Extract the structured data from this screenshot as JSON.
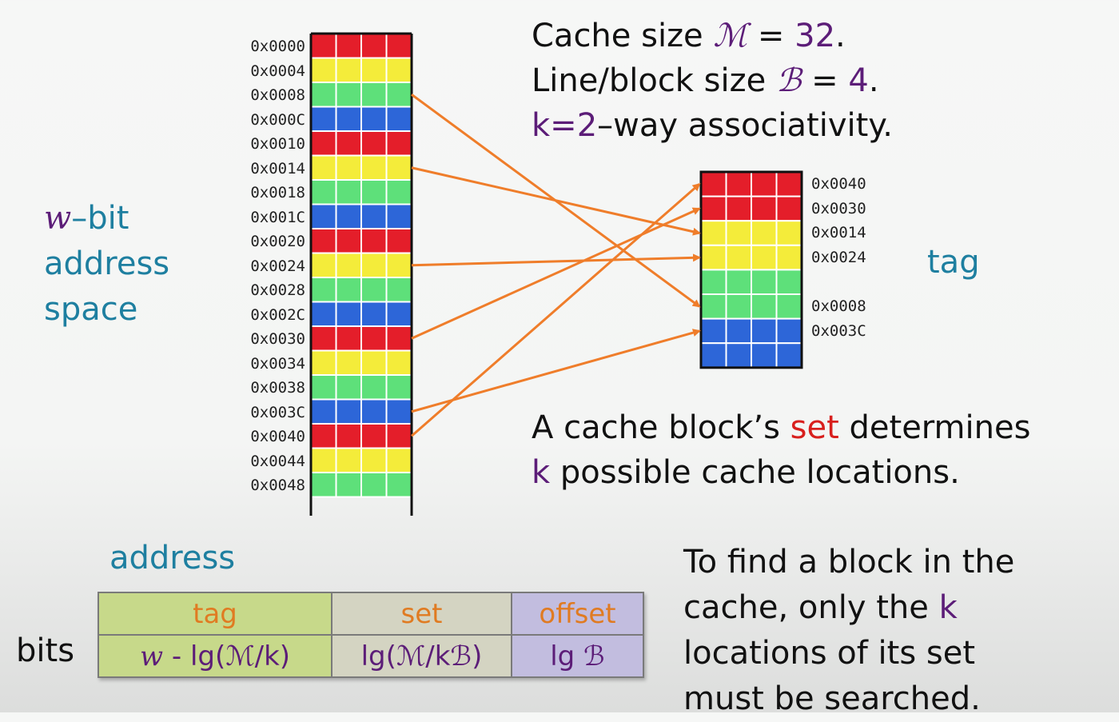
{
  "memory": {
    "addresses": [
      "0x0000",
      "0x0004",
      "0x0008",
      "0x000C",
      "0x0010",
      "0x0014",
      "0x0018",
      "0x001C",
      "0x0020",
      "0x0024",
      "0x0028",
      "0x002C",
      "0x0030",
      "0x0034",
      "0x0038",
      "0x003C",
      "0x0040",
      "0x0044",
      "0x0048"
    ],
    "row_colors": [
      "red",
      "yellow",
      "green",
      "blue",
      "red",
      "yellow",
      "green",
      "blue",
      "red",
      "yellow",
      "green",
      "blue",
      "red",
      "yellow",
      "green",
      "blue",
      "red",
      "yellow",
      "green"
    ]
  },
  "cache": {
    "tags": [
      "0x0040",
      "0x0030",
      "0x0014",
      "0x0024",
      "",
      "0x0008",
      "0x003C",
      ""
    ],
    "row_colors": [
      "red",
      "red",
      "yellow",
      "yellow",
      "green",
      "green",
      "blue",
      "blue"
    ]
  },
  "mappings": [
    {
      "from": "0x0008",
      "to_row": 5
    },
    {
      "from": "0x0014",
      "to_row": 2
    },
    {
      "from": "0x0024",
      "to_row": 3
    },
    {
      "from": "0x0030",
      "to_row": 1
    },
    {
      "from": "0x003C",
      "to_row": 6
    },
    {
      "from": "0x0040",
      "to_row": 0
    }
  ],
  "colors": {
    "red": "#e41e2a",
    "yellow": "#f4ec3a",
    "green": "#5ee07a",
    "blue": "#2d66d8",
    "arrow": "#ef7d2a",
    "teal": "#1e7fa0",
    "purple": "#5c1d78"
  },
  "header": {
    "line1_prefix": "Cache size ",
    "line1_sym": "ℳ",
    "line1_eq": " = ",
    "line1_val": "32",
    "line1_end": ".",
    "line2_prefix": "Line/block size ",
    "line2_sym": "ℬ",
    "line2_eq": " = ",
    "line2_val": "4",
    "line2_end": ".",
    "line3_k": "k",
    "line3_eq": "=",
    "line3_val": "2",
    "line3_rest": "–way associativity."
  },
  "left_label": {
    "w": "w",
    "bit": "–bit",
    "line2": "address",
    "line3": "space"
  },
  "tag_label": "tag",
  "set_note": {
    "line1_a": "A cache block’s ",
    "line1_set": "set",
    "line1_b": " determines",
    "line2_k": "k",
    "line2_rest": " possible cache locations."
  },
  "address_title": "address",
  "bits_label": "bits",
  "bits_table": {
    "tag_header": "tag",
    "set_header": "set",
    "offset_header": "offset",
    "tag_formula_w": "w",
    "tag_formula_rest": " - lg(ℳ/k)",
    "set_formula": "lg(ℳ/kℬ)",
    "offset_formula": "lg ℬ"
  },
  "find_note": {
    "line1": "To find a block in the",
    "line2_a": "cache, only the ",
    "line2_k": "k",
    "line3": "locations of its set",
    "line4": "must be searched."
  }
}
